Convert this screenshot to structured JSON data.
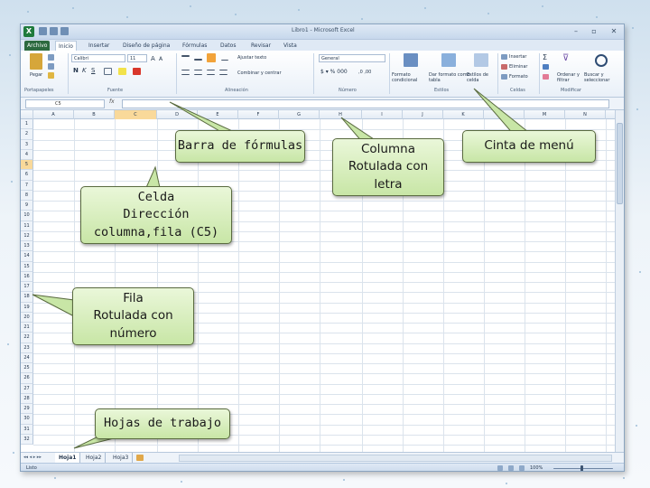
{
  "window": {
    "title": "Libro1 - Microsoft Excel",
    "logo": "X",
    "controls": [
      "–",
      "▫",
      "✕"
    ]
  },
  "tabs": [
    "Archivo",
    "Inicio",
    "Insertar",
    "Diseño de página",
    "Fórmulas",
    "Datos",
    "Revisar",
    "Vista"
  ],
  "ribbon": {
    "paste_label": "Pegar",
    "font_name": "Calibri",
    "font_size": "11",
    "bold": "N",
    "italic": "K",
    "underline": "S",
    "wrap_text": "Ajustar texto",
    "merge_center": "Combinar y centrar",
    "number_format": "General",
    "cond_format": "Formato condicional",
    "format_table": "Dar formato como tabla",
    "cell_styles": "Estilos de celda",
    "insert": "Insertar",
    "delete": "Eliminar",
    "format": "Formato",
    "sort_filter": "Ordenar y filtrar",
    "find_select": "Buscar y seleccionar",
    "groups": [
      "Portapapeles",
      "Fuente",
      "Alineación",
      "Número",
      "Estilos",
      "Celdas",
      "Modificar"
    ]
  },
  "formula_bar": {
    "name_box": "C5",
    "fx": "fx"
  },
  "grid": {
    "columns": [
      "A",
      "B",
      "C",
      "D",
      "E",
      "F",
      "G",
      "H",
      "I",
      "J",
      "K",
      "L",
      "M",
      "N"
    ],
    "rows": [
      "1",
      "2",
      "3",
      "4",
      "5",
      "6",
      "7",
      "8",
      "9",
      "10",
      "11",
      "12",
      "13",
      "14",
      "15",
      "16",
      "17",
      "18",
      "19",
      "20",
      "21",
      "22",
      "23",
      "24",
      "25",
      "26",
      "27",
      "28",
      "29",
      "30",
      "31",
      "32"
    ],
    "active_cell": "C5"
  },
  "sheets": {
    "nav": "◂◂ ◂ ▸ ▸▸",
    "tabs": [
      "Hoja1",
      "Hoja2",
      "Hoja3"
    ]
  },
  "status": {
    "left": "Listo",
    "zoom": "100%"
  },
  "callouts": {
    "formula_bar": "Barra de fórmulas",
    "column": "Columna\nRotulada con\nletra",
    "ribbon": "Cinta de menú",
    "cell": "Celda\nDirección\ncolumna,fila (C5)",
    "row": "Fila\nRotulada con\nnúmero",
    "sheets": "Hojas de trabajo"
  },
  "colors": {
    "callout_fill": "#c8e6a6",
    "file_tab": "#2d6a3f",
    "selected_header": "#f9d99a"
  }
}
